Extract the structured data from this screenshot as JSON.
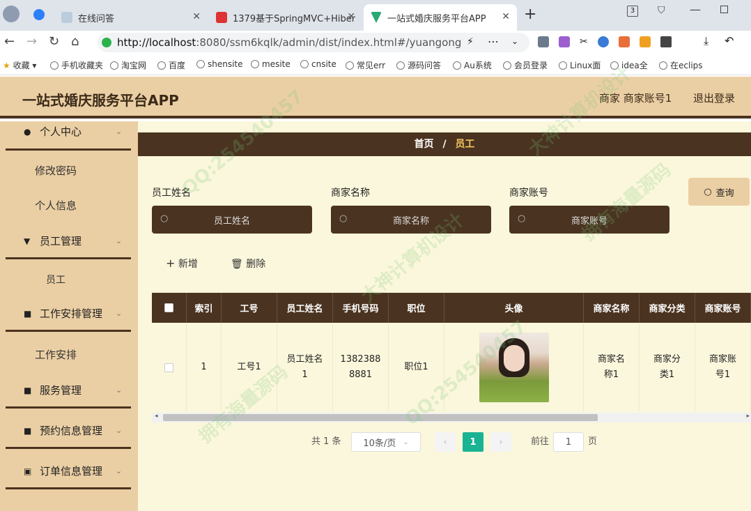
{
  "browser": {
    "tabs": [
      {
        "label": "在线问答"
      },
      {
        "label": "1379基于SpringMVC+Hiber"
      },
      {
        "label": "一站式婚庆服务平台APP"
      }
    ],
    "new_tab": "+",
    "address_host": "http://localhost",
    "address_rest": ":8080/ssm6kqlk/admin/dist/index.html#/yuangong",
    "window_badge": "3",
    "bookmarks": [
      "收藏",
      "手机收藏夹",
      "淘宝网",
      "百度",
      "shensite",
      "mesite",
      "cnsite",
      "常见err",
      "源码问答",
      "Au系统",
      "会员登录",
      "Linux面",
      "idea全",
      "在eclips"
    ]
  },
  "header": {
    "brand": "一站式婚庆服务平台APP",
    "user": "商家 商家账号1",
    "logout": "退出登录"
  },
  "sidebar": {
    "groups": [
      {
        "label": "个人中心",
        "icon": "user-icon"
      },
      {
        "label": "员工管理",
        "icon": "staff-icon"
      },
      {
        "label": "工作安排管理",
        "icon": "grid-icon"
      },
      {
        "label": "服务管理",
        "icon": "grid-icon"
      },
      {
        "label": "预约信息管理",
        "icon": "grid-icon"
      },
      {
        "label": "订单信息管理",
        "icon": "chart-icon"
      }
    ],
    "subitems": {
      "change_password": "修改密码",
      "profile": "个人信息",
      "employee": "员工",
      "schedule": "工作安排"
    }
  },
  "breadcrumb": {
    "home": "首页",
    "sep": "/",
    "current": "员工"
  },
  "filters": {
    "name_label": "员工姓名",
    "name_placeholder": "员工姓名",
    "merchant_label": "商家名称",
    "merchant_placeholder": "商家名称",
    "account_label": "商家账号",
    "account_placeholder": "商家账号",
    "query": "查询"
  },
  "actions": {
    "add": "新增",
    "delete": "删除"
  },
  "table": {
    "headers": [
      "索引",
      "工号",
      "员工姓名",
      "手机号码",
      "职位",
      "头像",
      "商家名称",
      "商家分类",
      "商家账号"
    ],
    "rows": [
      {
        "index": "1",
        "no": "工号1",
        "name": "员工姓名1",
        "phone": "13823888881",
        "position": "职位1",
        "merchant": "商家名称1",
        "category": "商家分类1",
        "account": "商家账号1"
      }
    ]
  },
  "pagination": {
    "total": "共 1 条",
    "page_size": "10条/页",
    "current": "1",
    "goto": "前往",
    "goto_value": "1",
    "page_unit": "页"
  },
  "watermarks": [
    "QQ:254540457",
    "拥有海量源码",
    "大神计算机设计",
    "QQ:254540457",
    "拥有海量源码",
    "大神计算机设计"
  ],
  "colors": {
    "accent": "#4a3320",
    "sand": "#ebcfa4",
    "cream": "#fbf7dc",
    "active_page": "#1ab394",
    "crumb_current": "#f3c463"
  }
}
